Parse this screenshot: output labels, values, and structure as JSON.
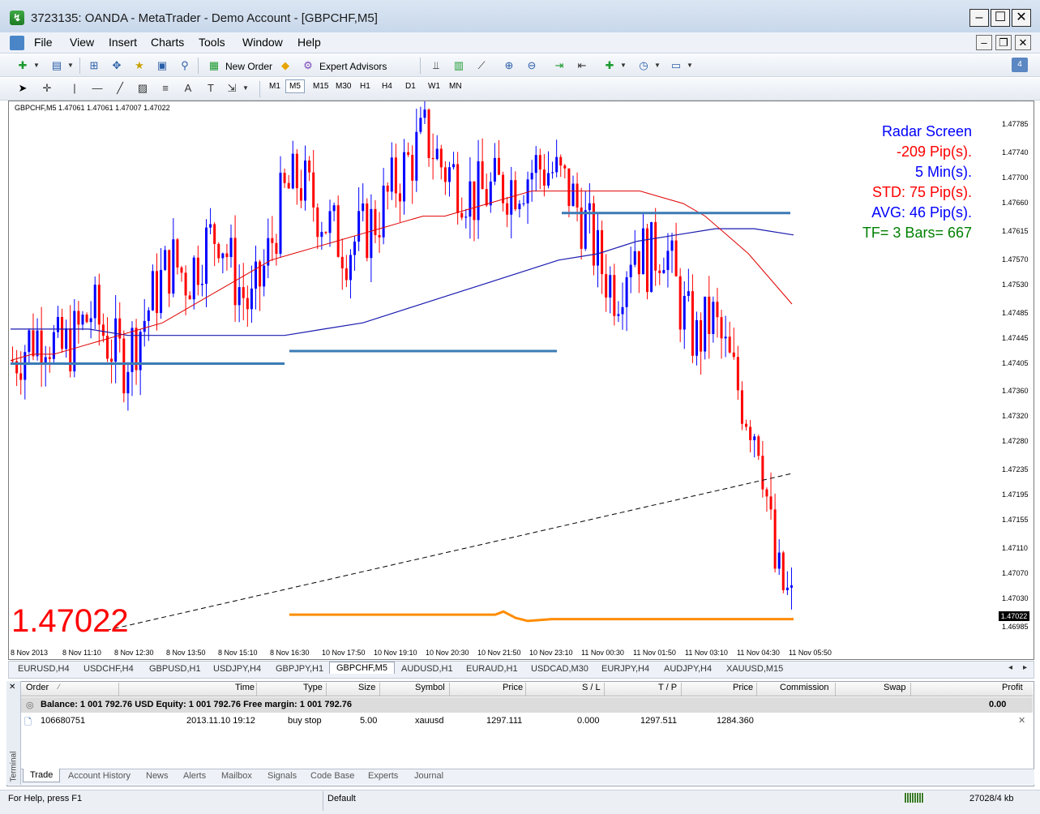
{
  "window": {
    "title": "3723135: OANDA - MetaTrader - Demo Account - [GBPCHF,M5]",
    "controls": [
      "minimize",
      "maximize",
      "close"
    ]
  },
  "menu": {
    "items": [
      "File",
      "View",
      "Insert",
      "Charts",
      "Tools",
      "Window",
      "Help"
    ]
  },
  "toolbar": {
    "new_order": "New Order",
    "expert_advisors": "Expert Advisors",
    "timeframes": [
      "M1",
      "M5",
      "M15",
      "M30",
      "H1",
      "H4",
      "D1",
      "W1",
      "MN"
    ],
    "active_timeframe": "M5"
  },
  "chart": {
    "header": "GBPCHF,M5  1.47061 1.47061 1.47007 1.47022",
    "big_price": "1.47022",
    "price_tag": "1.47022",
    "radar": {
      "title": "Radar Screen",
      "pips": "-209 Pip(s).",
      "period": "5 Min(s).",
      "std": "STD: 75 Pip(s).",
      "avg": "AVG: 46 Pip(s).",
      "tf": "TF= 3 Bars= 667"
    },
    "colors": {
      "bull": "#0000ff",
      "bear": "#ff0000",
      "ma_fast": "#e00000",
      "ma_slow": "#1a1ab0",
      "levels": "#3b7bb5",
      "radar_blue": "#0000ff",
      "radar_red": "#ff0000",
      "radar_green": "#008000",
      "orange": "#ff8c00"
    }
  },
  "chart_data": {
    "type": "line",
    "title": "GBPCHF,M5",
    "y_ticks": [
      "1.47785",
      "1.47740",
      "1.47700",
      "1.47660",
      "1.47615",
      "1.47570",
      "1.47530",
      "1.47485",
      "1.47445",
      "1.47405",
      "1.47360",
      "1.47320",
      "1.47280",
      "1.47235",
      "1.47195",
      "1.47155",
      "1.47110",
      "1.47070",
      "1.47030",
      "1.46985"
    ],
    "x_ticks": [
      "8 Nov 2013",
      "8 Nov 11:10",
      "8 Nov 12:30",
      "8 Nov 13:50",
      "8 Nov 15:10",
      "8 Nov 16:30",
      "10 Nov 17:50",
      "10 Nov 19:10",
      "10 Nov 20:30",
      "10 Nov 21:50",
      "10 Nov 23:10",
      "11 Nov 00:30",
      "11 Nov 01:50",
      "11 Nov 03:10",
      "11 Nov 04:30",
      "11 Nov 05:50"
    ],
    "ylim": [
      1.4696,
      1.4781
    ],
    "price_series": [
      1.4741,
      1.4744,
      1.4746,
      1.4742,
      1.4745,
      1.4749,
      1.4744,
      1.4741,
      1.4746,
      1.4752,
      1.4757,
      1.4754,
      1.4759,
      1.4762,
      1.4754,
      1.4749,
      1.4757,
      1.4767,
      1.477,
      1.4766,
      1.4762,
      1.4759,
      1.4761,
      1.4764,
      1.4769,
      1.4773,
      1.4777,
      1.4772,
      1.477,
      1.4767,
      1.4768,
      1.4769,
      1.477,
      1.4772,
      1.4771,
      1.4768,
      1.4763,
      1.4756,
      1.4752,
      1.476,
      1.4757,
      1.476,
      1.475,
      1.4744,
      1.4748,
      1.4741,
      1.4734,
      1.4729,
      1.4707,
      1.4702
    ],
    "ma_fast": [
      1.4741,
      1.4742,
      1.4742,
      1.4743,
      1.4744,
      1.4745,
      1.4746,
      1.4747,
      1.4749,
      1.4751,
      1.4753,
      1.4755,
      1.4757,
      1.4758,
      1.4759,
      1.476,
      1.4761,
      1.4762,
      1.4763,
      1.4764,
      1.4764,
      1.4765,
      1.4766,
      1.4767,
      1.4768,
      1.4768,
      1.4768,
      1.4768,
      1.4768,
      1.4768,
      1.4767,
      1.4766,
      1.4764,
      1.4761,
      1.4758,
      1.4754,
      1.475
    ],
    "ma_slow": [
      1.4746,
      1.4746,
      1.4746,
      1.4745,
      1.4745,
      1.4745,
      1.4745,
      1.4745,
      1.4746,
      1.4747,
      1.4749,
      1.4751,
      1.4753,
      1.4755,
      1.4757,
      1.4758,
      1.476,
      1.4761,
      1.4762,
      1.4762,
      1.4761
    ],
    "levels": [
      1.47405,
      1.47425,
      1.47645,
      1.47005
    ]
  },
  "chart_tabs": {
    "items": [
      "EURUSD,H4",
      "USDCHF,H4",
      "GBPUSD,H1",
      "USDJPY,H4",
      "GBPJPY,H1",
      "GBPCHF,M5",
      "AUDUSD,H1",
      "EURAUD,H1",
      "USDCAD,M30",
      "EURJPY,H4",
      "AUDJPY,H4",
      "XAUUSD,M15"
    ],
    "active": "GBPCHF,M5"
  },
  "terminal": {
    "side_label": "Terminal",
    "columns": [
      "Order",
      "Time",
      "Type",
      "Size",
      "Symbol",
      "Price",
      "S / L",
      "T / P",
      "Price",
      "Commission",
      "Swap",
      "Profit"
    ],
    "balance_text": "Balance: 1 001 792.76 USD  Equity: 1 001 792.76  Free margin: 1 001 792.76",
    "balance_profit": "0.00",
    "order": {
      "order": "106680751",
      "time": "2013.11.10 19:12",
      "type": "buy stop",
      "size": "5.00",
      "symbol": "xauusd",
      "price": "1297.111",
      "sl": "0.000",
      "tp": "1297.511",
      "price2": "1284.360"
    },
    "tabs": [
      "Trade",
      "Account History",
      "News",
      "Alerts",
      "Mailbox",
      "Signals",
      "Code Base",
      "Experts",
      "Journal"
    ],
    "active_tab": "Trade"
  },
  "status": {
    "help": "For Help, press F1",
    "profile": "Default",
    "memory": "27028/4 kb"
  }
}
